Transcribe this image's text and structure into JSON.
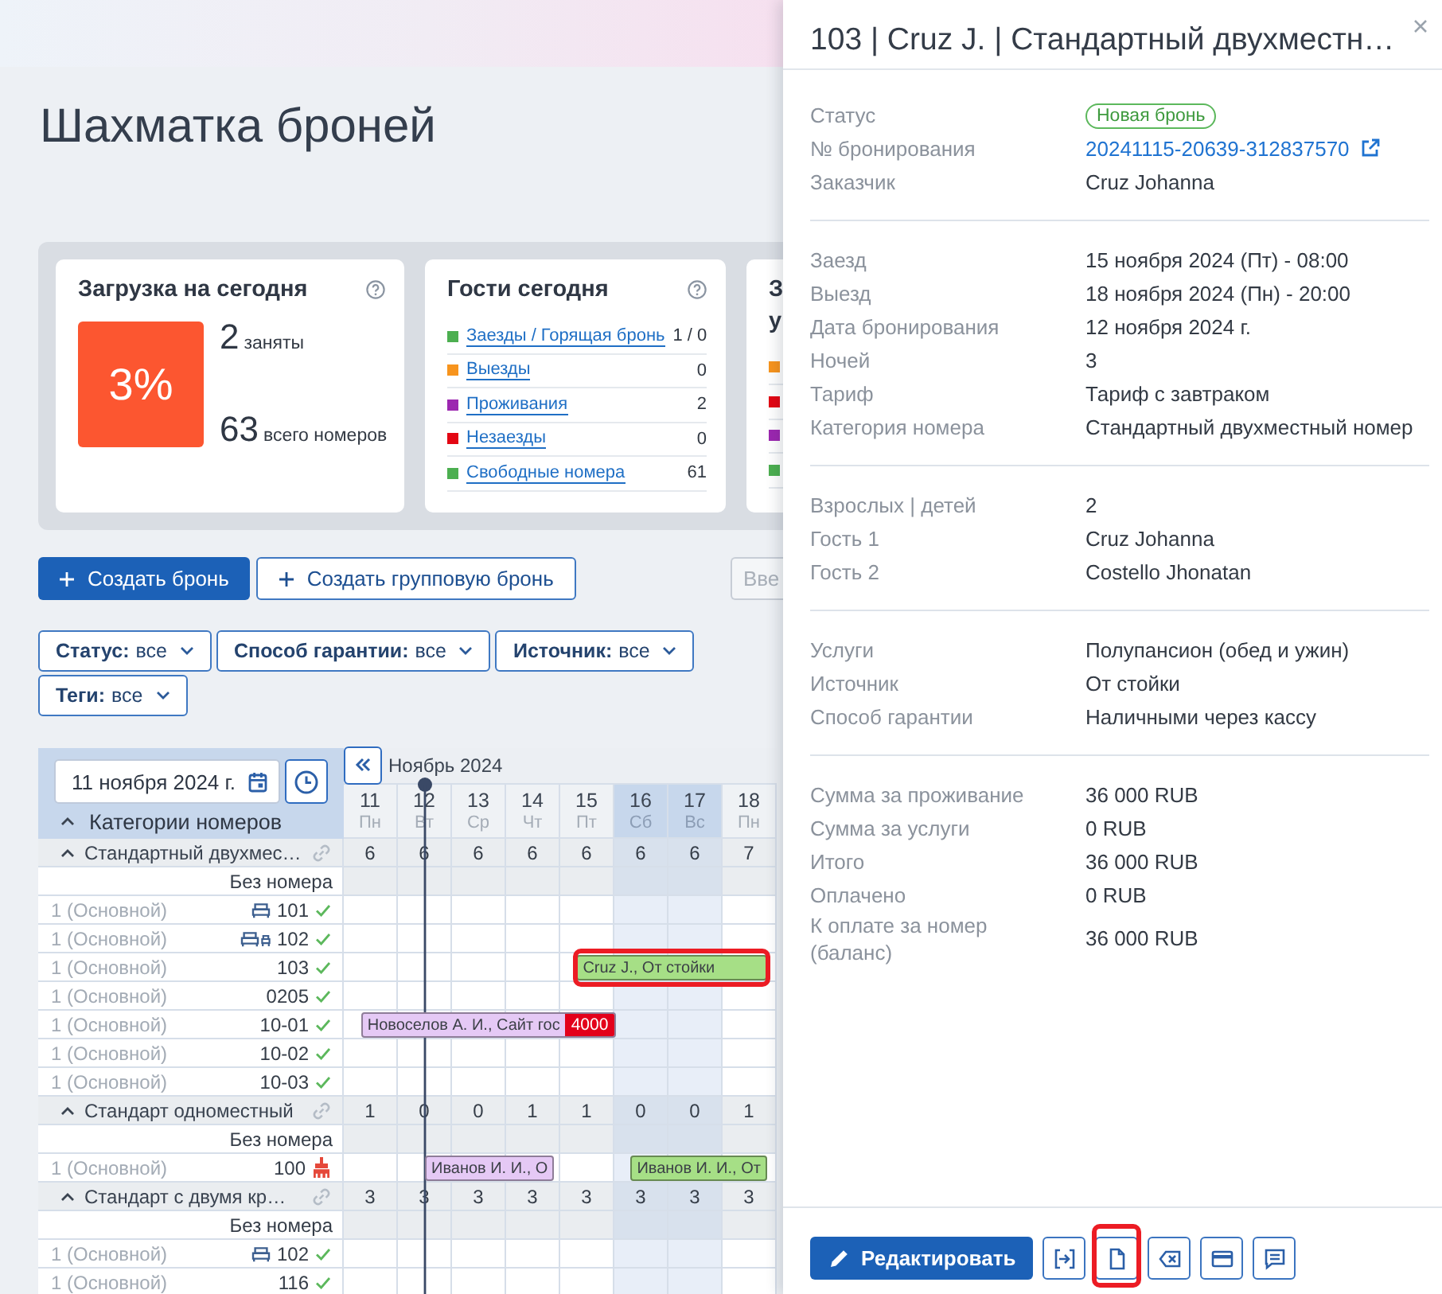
{
  "page": {
    "title": "Шахматка броней"
  },
  "summary": [
    {
      "kind": "load",
      "title": "Загрузка на сегодня",
      "help": true,
      "percent": "3%",
      "stats": [
        {
          "value": "2",
          "label": "заняты"
        },
        {
          "value": "63",
          "label": "всего номеров"
        }
      ]
    },
    {
      "kind": "list",
      "title": "Гости сегодня",
      "help": true,
      "items": [
        {
          "label": "Заезды / Горящая бронь",
          "count": "1 / 0",
          "color": "#4caf50"
        },
        {
          "label": "Выезды",
          "count": "0",
          "color": "#f7941d"
        },
        {
          "label": "Проживания",
          "count": "2",
          "color": "#9c27b0"
        },
        {
          "label": "Незаезды",
          "count": "0",
          "color": "#e30613"
        },
        {
          "label": "Свободные номера",
          "count": "61",
          "color": "#4caf50"
        }
      ]
    },
    {
      "kind": "list",
      "title_lines": [
        "З",
        "у"
      ],
      "items": [
        {
          "color": "#f7941d"
        },
        {
          "color": "#e30613"
        },
        {
          "color": "#9c27b0"
        },
        {
          "color": "#4caf50"
        }
      ]
    }
  ],
  "actions": {
    "create": "Создать бронь",
    "create_group": "Создать групповую бронь",
    "search": {
      "placeholder": "Вве"
    }
  },
  "filters": [
    {
      "label": "Статус:",
      "value": "все"
    },
    {
      "label": "Способ гарантии:",
      "value": "все"
    },
    {
      "label": "Источник:",
      "value": "все"
    },
    {
      "label": "Теги:",
      "value": "все"
    }
  ],
  "calendar": {
    "date": "11 ноября 2024 г.",
    "categories_label": "Категории номеров",
    "categories_expanded": true,
    "month": "Ноябрь 2024",
    "days": [
      {
        "day": "11",
        "weekday": "Пн",
        "weekend": false,
        "today": false
      },
      {
        "day": "12",
        "weekday": "Вт",
        "weekend": false,
        "today": true
      },
      {
        "day": "13",
        "weekday": "Ср",
        "weekend": false,
        "today": false
      },
      {
        "day": "14",
        "weekday": "Чт",
        "weekend": false,
        "today": false
      },
      {
        "day": "15",
        "weekday": "Пт",
        "weekend": false,
        "today": false
      },
      {
        "day": "16",
        "weekday": "Сб",
        "weekend": true,
        "today": false
      },
      {
        "day": "17",
        "weekday": "Вс",
        "weekend": true,
        "today": false
      },
      {
        "day": "18",
        "weekday": "Пн",
        "weekend": false,
        "today": false
      }
    ],
    "groups": [
      {
        "name": "Стандартный двухмес…",
        "expanded": true,
        "counts": [
          "6",
          "6",
          "6",
          "6",
          "6",
          "6",
          "6",
          "7"
        ],
        "rows": [
          {
            "kind": "unassigned",
            "label": "Без номера"
          },
          {
            "kind": "room",
            "rate": "1 (Основной)",
            "bed": true,
            "extra_bed": false,
            "number": "101",
            "clean": true
          },
          {
            "kind": "room",
            "rate": "1 (Основной)",
            "bed": true,
            "extra_bed": true,
            "number": "102",
            "clean": true
          },
          {
            "kind": "room",
            "rate": "1 (Основной)",
            "bed": false,
            "extra_bed": false,
            "number": "103",
            "clean": true,
            "bookings": [
              {
                "text": "Cruz J., От стойки",
                "color": "#a6df86",
                "highlighted": true
              }
            ]
          },
          {
            "kind": "room",
            "rate": "1 (Основной)",
            "bed": false,
            "extra_bed": false,
            "number": "0205",
            "clean": true
          },
          {
            "kind": "room",
            "rate": "1 (Основной)",
            "bed": false,
            "extra_bed": false,
            "number": "10-01",
            "clean": true,
            "bookings": [
              {
                "text": "Новоселов А. И., Сайт гос",
                "badge": "4000",
                "color": "#e5c9f5",
                "highlighted": false
              }
            ]
          },
          {
            "kind": "room",
            "rate": "1 (Основной)",
            "bed": false,
            "extra_bed": false,
            "number": "10-02",
            "clean": true
          },
          {
            "kind": "room",
            "rate": "1 (Основной)",
            "bed": false,
            "extra_bed": false,
            "number": "10-03",
            "clean": true
          }
        ]
      },
      {
        "name": "Стандарт одноместный",
        "expanded": true,
        "counts": [
          "1",
          "0",
          "0",
          "1",
          "1",
          "0",
          "0",
          "1"
        ],
        "rows": [
          {
            "kind": "unassigned",
            "label": "Без номера"
          },
          {
            "kind": "room",
            "rate": "1 (Основной)",
            "bed": false,
            "extra_bed": false,
            "number": "100",
            "clean": false,
            "bookings": [
              {
                "text": "Иванов И. И., О",
                "color": "#e5c9f5",
                "highlighted": false
              },
              {
                "text": "Иванов И. И., От",
                "color": "#a6df86",
                "highlighted": false
              }
            ]
          }
        ]
      },
      {
        "name": "Стандарт с двумя кр…",
        "expanded": true,
        "counts": [
          "3",
          "3",
          "3",
          "3",
          "3",
          "3",
          "3",
          "3"
        ],
        "rows": [
          {
            "kind": "unassigned",
            "label": "Без номера"
          },
          {
            "kind": "room",
            "rate": "1 (Основной)",
            "bed": true,
            "extra_bed": false,
            "number": "102",
            "clean": true
          },
          {
            "kind": "room",
            "rate": "1 (Основной)",
            "bed": false,
            "extra_bed": false,
            "number": "116",
            "clean": true
          }
        ]
      }
    ]
  },
  "booking_panel": {
    "title": "103 | Cruz J. | Стандартный двухместн…",
    "sections": [
      {
        "rows": [
          {
            "label": "Статус",
            "value": "Новая бронь",
            "kind": "status"
          },
          {
            "label": "№ бронирования",
            "value": "20241115-20639-312837570",
            "kind": "link"
          },
          {
            "label": "Заказчик",
            "value": "Cruz Johanna",
            "kind": "text"
          }
        ]
      },
      {
        "rows": [
          {
            "label": "Заезд",
            "value": "15 ноября 2024 (Пт) - 08:00",
            "kind": "text"
          },
          {
            "label": "Выезд",
            "value": "18 ноября 2024 (Пн) - 20:00",
            "kind": "text"
          },
          {
            "label": "Дата бронирования",
            "value": "12 ноября 2024 г.",
            "kind": "text"
          },
          {
            "label": "Ночей",
            "value": "3",
            "kind": "text"
          },
          {
            "label": "Тариф",
            "value": "Тариф с завтраком",
            "kind": "text"
          },
          {
            "label": "Категория номера",
            "value": "Стандартный двухместный номер",
            "kind": "text"
          }
        ]
      },
      {
        "rows": [
          {
            "label": "Взрослых | детей",
            "value": "2",
            "kind": "text"
          },
          {
            "label": "Гость 1",
            "value": "Cruz Johanna",
            "kind": "text"
          },
          {
            "label": "Гость 2",
            "value": "Costello Jhonatan",
            "kind": "text"
          }
        ]
      },
      {
        "rows": [
          {
            "label": "Услуги",
            "value": "Полупансион (обед и ужин)",
            "kind": "text"
          },
          {
            "label": "Источник",
            "value": "От стойки",
            "kind": "text"
          },
          {
            "label": "Способ гарантии",
            "value": "Наличными через кассу",
            "kind": "text"
          }
        ]
      },
      {
        "rows": [
          {
            "label": "Сумма за проживание",
            "value": "36 000 RUB",
            "kind": "text"
          },
          {
            "label": "Сумма за услуги",
            "value": "0 RUB",
            "kind": "text"
          },
          {
            "label": "Итого",
            "value": "36 000 RUB",
            "kind": "text"
          },
          {
            "label": "Оплачено",
            "value": "0 RUB",
            "kind": "text"
          },
          {
            "label": "К оплате за номер (баланс)",
            "value": "36 000 RUB",
            "kind": "text"
          }
        ]
      }
    ],
    "footer": {
      "edit": "Редактировать",
      "tools": [
        {
          "kind": "check-in",
          "highlighted": false
        },
        {
          "kind": "document",
          "highlighted": true
        },
        {
          "kind": "cancel",
          "highlighted": false
        },
        {
          "kind": "payment",
          "highlighted": false
        },
        {
          "kind": "comment",
          "highlighted": false
        }
      ]
    }
  }
}
